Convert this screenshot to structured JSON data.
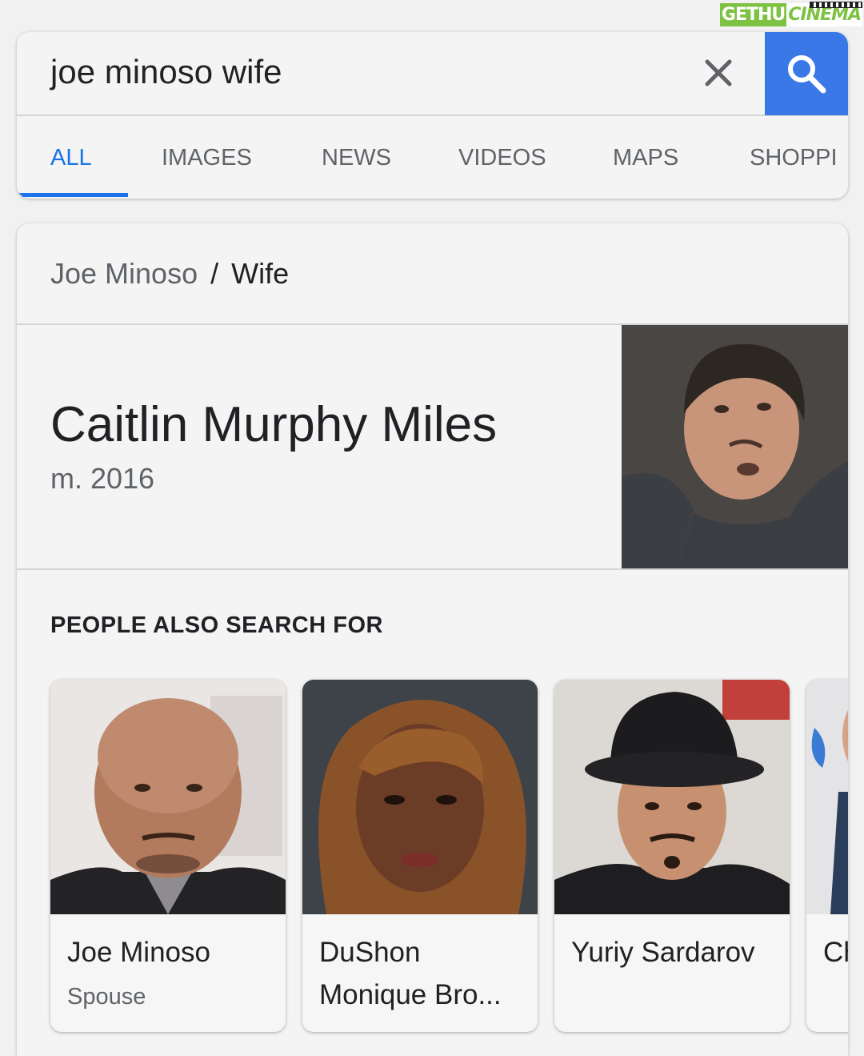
{
  "watermark": {
    "part1": "GETHU",
    "part2": "CINEMA"
  },
  "search": {
    "query": "joe minoso wife",
    "clear_icon": "close-icon",
    "search_icon": "search-icon",
    "accent": "#3b78e7"
  },
  "tabs": [
    {
      "label": "ALL",
      "active": true
    },
    {
      "label": "IMAGES",
      "active": false
    },
    {
      "label": "NEWS",
      "active": false
    },
    {
      "label": "VIDEOS",
      "active": false
    },
    {
      "label": "MAPS",
      "active": false
    },
    {
      "label": "SHOPPI",
      "active": false
    }
  ],
  "knowledge": {
    "breadcrumb": {
      "parent": "Joe Minoso",
      "separator": "/",
      "child": "Wife"
    },
    "answer": {
      "name": "Caitlin Murphy Miles",
      "detail": "m. 2016"
    },
    "section_title": "PEOPLE ALSO SEARCH FOR",
    "people": [
      {
        "name": "Joe Minoso",
        "role": "Spouse"
      },
      {
        "name": "DuShon Monique Bro...",
        "role": ""
      },
      {
        "name": "Yuriy Sardarov",
        "role": ""
      },
      {
        "name": "Chr",
        "role": ""
      }
    ]
  }
}
